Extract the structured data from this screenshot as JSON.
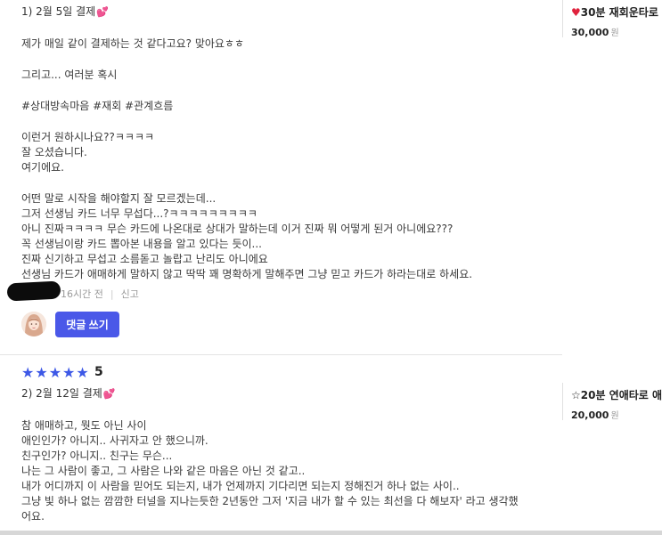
{
  "review1": {
    "title": "1) 2월 5일 결제",
    "heart": "💕",
    "lines": [
      "제가 매일 같이 결제하는 것 같다고요? 맞아요ㅎㅎ",
      "그리고... 여러분 혹시",
      "#상대방속마음 #재회 #관계흐름",
      "이런거 원하시나요??ㅋㅋㅋㅋ",
      "잘 오셨습니다.",
      "여기에요.",
      "어떤 말로 시작을 해야할지 잘 모르겠는데...",
      "그저 선생님 카드 너무 무섭다...?ㅋㅋㅋㅋㅋㅋㅋㅋㅋ",
      "아니 진짜ㅋㅋㅋㅋ 무슨 카드에 나온대로 상대가 말하는데 이거 진짜 뭐 어떻게 된거 아니에요???",
      "꼭 선생님이랑 카드 뽑아본 내용을 알고 있다는 듯이...",
      "진짜 신기하고 무섭고 소름돋고 놀랍고 난리도 아니에요",
      "선생님 카드가 애매하게 말하지 않고 딱딱 꽤 명확하게 말해주면 그냥 믿고 카드가 하라는대로 하세요."
    ],
    "time": "16시간 전",
    "report": "신고",
    "comment_button": "댓글 쓰기"
  },
  "product1": {
    "name": "30분 재회운타로",
    "price": "30,000",
    "unit": "원",
    "heart_color": "#e0223d"
  },
  "review2": {
    "stars": "★★★★★",
    "rating": "5",
    "title": "2) 2월 12일 결제",
    "heart": "💕",
    "lines": [
      "참 애매하고, 뭣도 아닌 사이",
      "애인인가? 아니지.. 사귀자고 안 했으니까.",
      "친구인가? 아니지.. 친구는 무슨...",
      "나는 그 사람이 좋고, 그 사람은 나와 같은 마음은 아닌 것 같고..",
      "내가 어디까지 이 사람을 믿어도 되는지, 내가 언제까지 기다리면 되는지 정해진거 하나 없는 사이..",
      "그냥 빛 하나 없는 깜깜한 터널을 지나는듯한 2년동안 그저 '지금 내가 할 수 있는 최선을 다 해보자' 라고 생각했",
      "어요."
    ]
  },
  "product2": {
    "name": "☆20분 연애타로 애",
    "price": "20,000",
    "unit": "원"
  },
  "colors": {
    "accent": "#4a58e8",
    "star": "#3d58e6",
    "heart": "#e8467c"
  }
}
